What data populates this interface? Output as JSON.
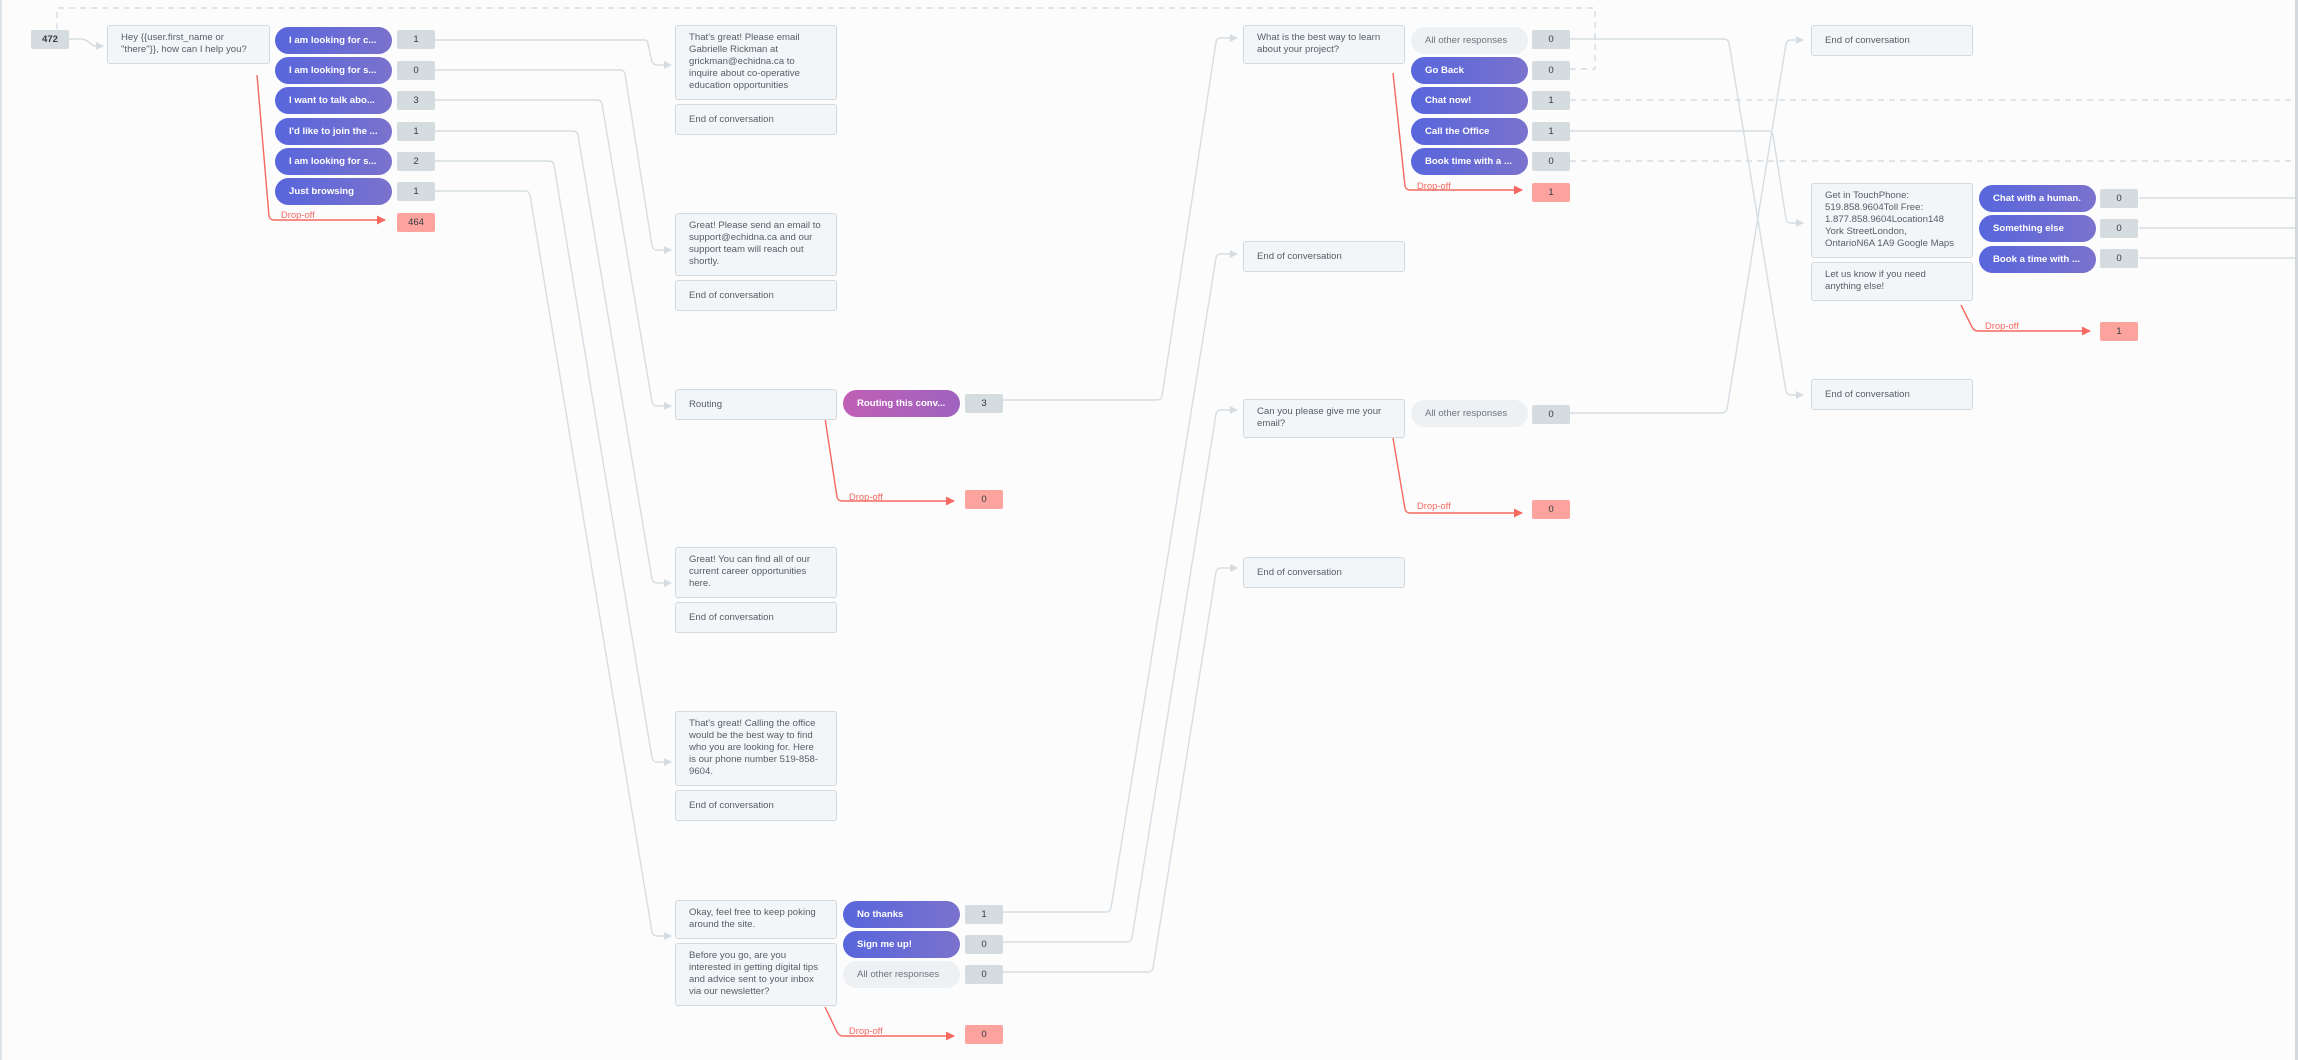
{
  "colors": {
    "pill_gradient_start": "#5866dc",
    "pill_gradient_end": "#7a72cd",
    "routing_gradient_start": "#c05fb5",
    "routing_gradient_end": "#9e63bf",
    "dropoff": "#f4685e",
    "dropoff_badge": "#fba39c",
    "connector": "#d6dde2"
  },
  "start": {
    "count": "472"
  },
  "greeting": {
    "text": "Hey {{user.first_name or \"there\"}}, how can I help you?",
    "options": [
      {
        "label": "I am looking for c...",
        "count": "1"
      },
      {
        "label": "I am looking for s...",
        "count": "0"
      },
      {
        "label": "I want to talk abo...",
        "count": "3"
      },
      {
        "label": "I'd like to join the ...",
        "count": "1"
      },
      {
        "label": "I am looking for s...",
        "count": "2"
      },
      {
        "label": "Just browsing",
        "count": "1"
      }
    ],
    "dropoff_label": "Drop-off",
    "dropoff_count": "464"
  },
  "coop": {
    "text": "That's great! Please email Gabrielle Rickman at grickman@echidna.ca to inquire about co-operative education opportunities",
    "end": "End of conversation"
  },
  "support": {
    "text": "Great! Please send an email to support@echidna.ca and our support team will reach out shortly.",
    "end": "End of conversation"
  },
  "routing": {
    "text": "Routing",
    "option": {
      "label": "Routing this conv...",
      "count": "3"
    },
    "dropoff_label": "Drop-off",
    "dropoff_count": "0"
  },
  "careers": {
    "text": "Great! You can find all of our current career opportunities here.",
    "end": "End of conversation"
  },
  "office": {
    "text": "That's great! Calling the office would be the best way to find who you are looking for. Here is our phone number 519-858-9604.",
    "end": "End of conversation"
  },
  "browsing": {
    "text": "Okay, feel free to keep poking around the site.",
    "question": "Before you go, are you interested in getting digital tips and advice sent to your inbox via our newsletter?",
    "options": [
      {
        "label": "No thanks",
        "count": "1"
      },
      {
        "label": "Sign me up!",
        "count": "0"
      },
      {
        "label": "All other responses",
        "count": "0"
      }
    ],
    "dropoff_label": "Drop-off",
    "dropoff_count": "0"
  },
  "project": {
    "text": "What is the best way to learn about your project?",
    "options": [
      {
        "label": "All other responses",
        "count": "0"
      },
      {
        "label": "Go Back",
        "count": "0"
      },
      {
        "label": "Chat now!",
        "count": "1"
      },
      {
        "label": "Call the Office",
        "count": "1"
      },
      {
        "label": "Book time with a ...",
        "count": "0"
      }
    ],
    "dropoff_label": "Drop-off",
    "dropoff_count": "1"
  },
  "end_a": {
    "text": "End of conversation"
  },
  "email": {
    "text": "Can you please give me your email?",
    "options": [
      {
        "label": "All other responses",
        "count": "0"
      }
    ],
    "dropoff_label": "Drop-off",
    "dropoff_count": "0"
  },
  "end_b": {
    "text": "End of conversation"
  },
  "end_c": {
    "text": "End of conversation"
  },
  "touch": {
    "text": "Get in TouchPhone: 519.858.9604Toll Free: 1.877.858.9604Location148 York StreetLondon, OntarioN6A 1A9 Google Maps",
    "followup": "Let us know if you need anything else!",
    "options": [
      {
        "label": "Chat with a human.",
        "count": "0"
      },
      {
        "label": "Something else",
        "count": "0"
      },
      {
        "label": "Book a time with ...",
        "count": "0"
      }
    ],
    "dropoff_label": "Drop-off",
    "dropoff_count": "1"
  },
  "end_d": {
    "text": "End of conversation"
  },
  "end_e": {
    "text": "End of conversation"
  }
}
